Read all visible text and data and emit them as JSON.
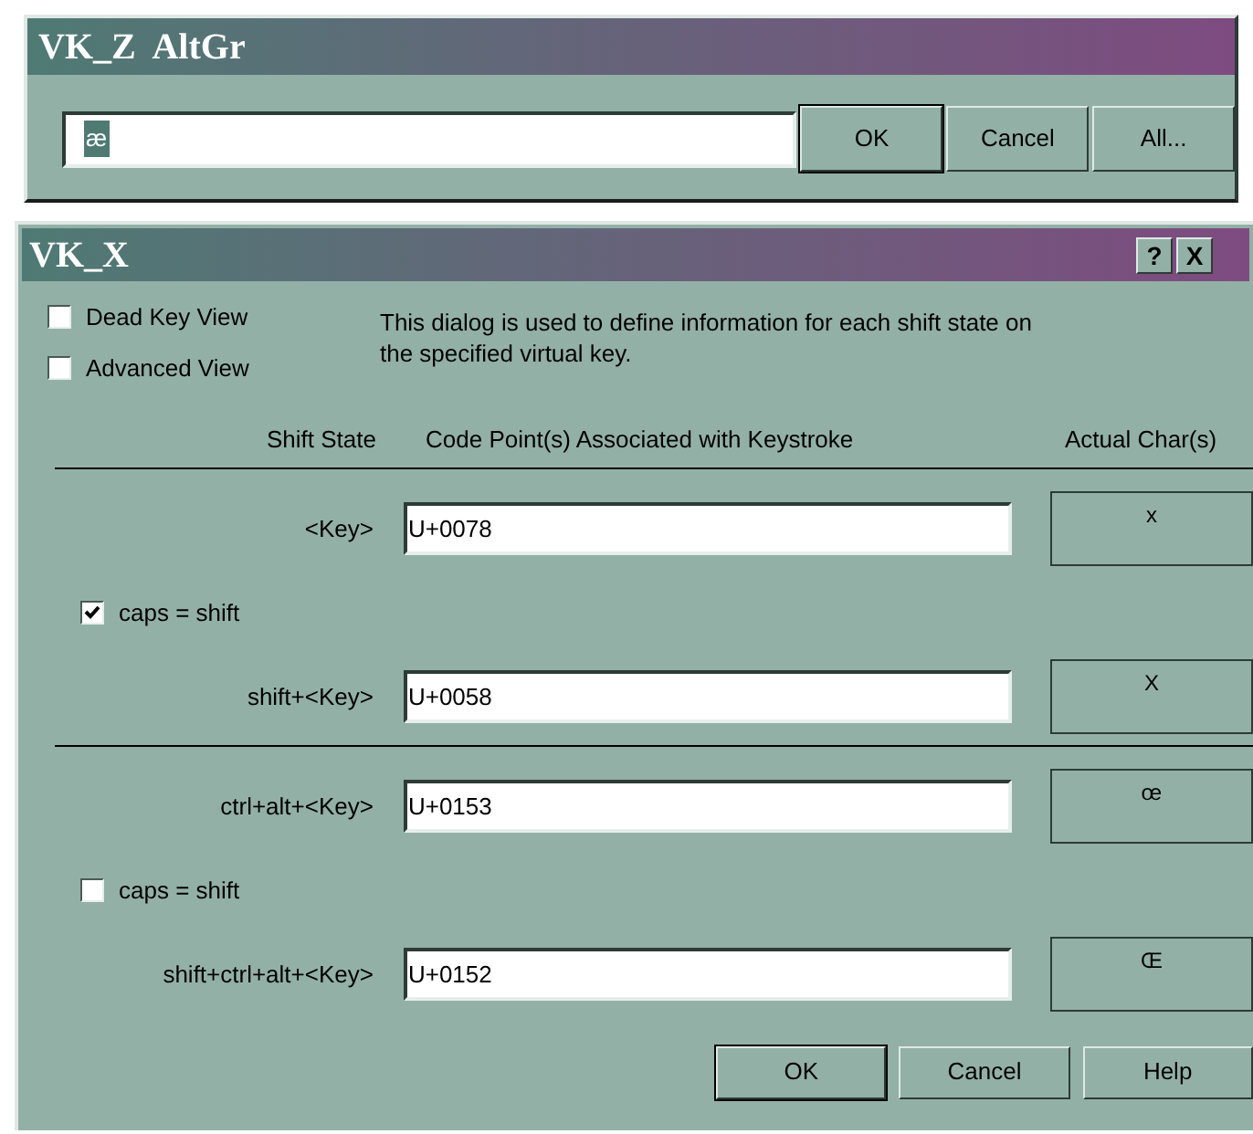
{
  "top_dialog": {
    "title": "VK_Z  AltGr",
    "field": {
      "value": "æ",
      "selected": true
    },
    "buttons": [
      {
        "label": "OK",
        "default": true
      },
      {
        "label": "Cancel",
        "default": false
      },
      {
        "label": "All...",
        "default": false
      }
    ]
  },
  "main_dialog": {
    "title": "VK_X",
    "title_buttons": [
      "?",
      "X"
    ],
    "options": [
      {
        "label": "Dead Key View",
        "checked": false
      },
      {
        "label": "Advanced View",
        "checked": false
      }
    ],
    "description": "This dialog is used to define information for each shift state on the specified virtual key.",
    "columns": [
      "Shift State",
      "Code Point(s) Associated with Keystroke",
      "Actual Char(s)"
    ],
    "groups": [
      {
        "rows": [
          {
            "kind": "key",
            "label": "<Key>",
            "code": "U+0078",
            "char": "x"
          },
          {
            "kind": "toggle",
            "label": "caps = shift",
            "checked": true
          },
          {
            "kind": "key",
            "label": "shift+<Key>",
            "code": "U+0058",
            "char": "X"
          }
        ]
      },
      {
        "rows": [
          {
            "kind": "key",
            "label": "ctrl+alt+<Key>",
            "code": "U+0153",
            "char": "œ"
          },
          {
            "kind": "toggle",
            "label": "caps = shift",
            "checked": false
          },
          {
            "kind": "key",
            "label": "shift+ctrl+alt+<Key>",
            "code": "U+0152",
            "char": "Œ"
          }
        ]
      }
    ],
    "buttons": [
      {
        "label": "OK",
        "default": true
      },
      {
        "label": "Cancel",
        "default": false
      },
      {
        "label": "Help",
        "default": false
      }
    ]
  }
}
